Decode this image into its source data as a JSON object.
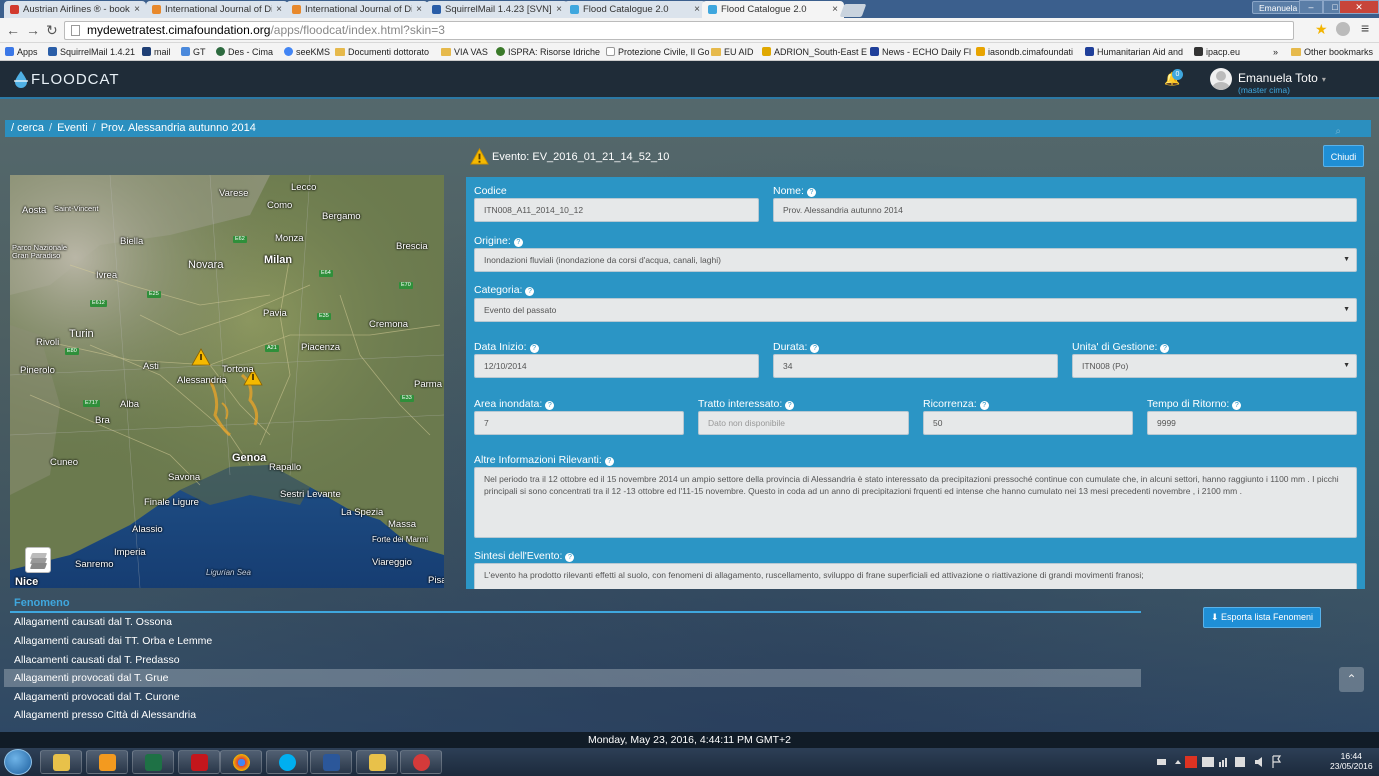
{
  "browser": {
    "tabs": [
      {
        "title": "Austrian Airlines ® - book",
        "color": "#d23a2e"
      },
      {
        "title": "International Journal of Di",
        "color": "#e8892c"
      },
      {
        "title": "International Journal of Di",
        "color": "#e8892c"
      },
      {
        "title": "SquirrelMail 1.4.23 [SVN]",
        "color": "#2a5ea8"
      },
      {
        "title": "Flood Catalogue 2.0",
        "color": "#3fa7de"
      },
      {
        "title": "Flood Catalogue 2.0",
        "color": "#3fa7de"
      }
    ],
    "window_user": "Emanuela",
    "url_host": "mydewetratest.cimafoundation.org",
    "url_path": "/apps/floodcat/index.html?skin=3",
    "bookmarks": [
      "Apps",
      "SquirrelMail 1.4.21",
      "mail",
      "GT",
      "Des - Cima",
      "seeKMS",
      "Documenti dottorato",
      "VIA VAS",
      "ISPRA: Risorse Idriche",
      "Protezione Civile, Il Go",
      "EU AID",
      "ADRION_South-East E",
      "News - ECHO Daily Fl",
      "iasondb.cimafoundati",
      "Humanitarian Aid and",
      "ipacp.eu"
    ],
    "other_bookmarks": "Other bookmarks",
    "more": "»"
  },
  "app": {
    "logo_text": "FLOODCAT",
    "notif_count": "0",
    "user_name": "Emanuela Toto",
    "user_role": "(master cima)"
  },
  "breadcrumb": {
    "root": "/ cerca",
    "item1": "Eventi",
    "item2": "Prov. Alessandria autunno 2014"
  },
  "event": {
    "title": "Evento: EV_2016_01_21_14_52_10",
    "close_label": "Chiudi"
  },
  "map": {
    "labels": [
      "Aosta",
      "Saint-Vincent",
      "Varese",
      "Como",
      "Lecco",
      "Bergamo",
      "Biella",
      "Monza",
      "Brescia",
      "Milan",
      "Novara",
      "Ivrea",
      "Parco Nazionale Gran Paradiso",
      "Pavia",
      "Cremona",
      "Turin",
      "Rivoli",
      "Piacenza",
      "Pinerolo",
      "Asti",
      "Tortona",
      "Alessandria",
      "Parma",
      "Alba",
      "Bra",
      "Cuneo",
      "Genoa",
      "Rapallo",
      "Savona",
      "Sestri Levante",
      "Finale Ligure",
      "La Spezia",
      "Massa",
      "Alassio",
      "Forte dei Marmi",
      "Imperia",
      "Viareggio",
      "Sanremo",
      "Ligurian Sea",
      "Nice",
      "Pisa"
    ],
    "roads": [
      "E62",
      "E25",
      "E612",
      "E70",
      "E64",
      "E35",
      "E717",
      "E33",
      "E80",
      "A21"
    ]
  },
  "form": {
    "codice_label": "Codice",
    "codice_value": "ITN008_A11_2014_10_12",
    "nome_label": "Nome:",
    "nome_value": "Prov. Alessandria autunno 2014",
    "origine_label": "Origine:",
    "origine_value": "Inondazioni fluviali (inondazione da corsi d'acqua, canali, laghi)",
    "categoria_label": "Categoria:",
    "categoria_value": "Evento del passato",
    "data_inizio_label": "Data Inizio:",
    "data_inizio_value": "12/10/2014",
    "durata_label": "Durata:",
    "durata_value": "34",
    "unita_label": "Unita' di Gestione:",
    "unita_value": "ITN008 (Po)",
    "area_label": "Area inondata:",
    "area_value": "7",
    "tratto_label": "Tratto interessato:",
    "tratto_placeholder": "Dato non disponibile",
    "ricorrenza_label": "Ricorrenza:",
    "ricorrenza_value": "50",
    "tempo_label": "Tempo di Ritorno:",
    "tempo_value": "9999",
    "altre_label": "Altre Informazioni Rilevanti:",
    "altre_value": "Nel periodo tra il 12 ottobre ed il 15 novembre 2014 un ampio settore della provincia di Alessandria è stato interessato da precipitazioni pressoché continue con cumulate che, in alcuni settori, hanno raggiunto i 1100 mm .  I picchi principali si sono concentrati tra il 12 -13 ottobre ed l'11-15 novembre.  Questo in coda ad un anno di precipitazioni frquenti ed intense che hanno cumulato nei 13 mesi precedenti novembre , i 2100 mm .",
    "sintesi_label": "Sintesi dell'Evento:",
    "sintesi_value": "L'evento ha prodotto rilevanti effetti al suolo, con  fenomeni di allagamento, ruscellamento, sviluppo di frane superficiali  ed attivazione o riattivazione di grandi movimenti franosi;"
  },
  "fenomeno": {
    "header": "Fenomeno",
    "export_label": "Esporta lista Fenomeni",
    "items": [
      "Allagamenti causati dal T. Ossona",
      "Allagamenti causati dai TT. Orba e Lemme",
      "Allacamenti causati dal T. Predasso",
      "Allagamenti provocati dal T. Grue",
      "Allagamenti provocati dal T. Curone",
      "Allagamenti presso Città di Alessandria"
    ]
  },
  "status_text": "Monday, May 23, 2016, 4:44:11 PM GMT+2",
  "taskbar": {
    "time": "16:44",
    "date": "23/05/2016"
  },
  "colors": {
    "accent": "#2b95c5",
    "button": "#1f8fd6",
    "link": "#3fa7de"
  }
}
